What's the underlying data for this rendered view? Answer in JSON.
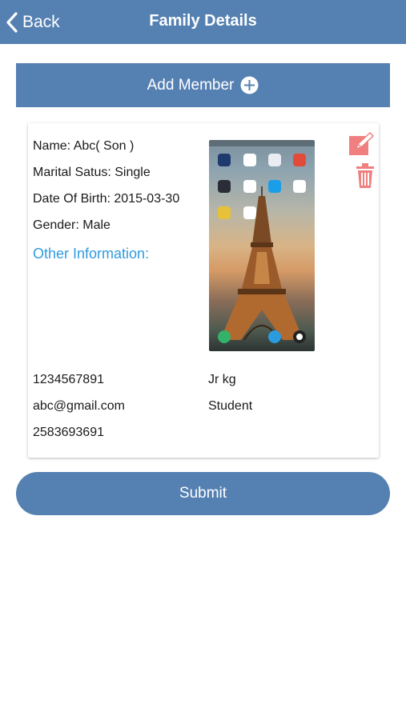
{
  "header": {
    "back_label": "Back",
    "title": "Family Details"
  },
  "add_member": {
    "label": "Add Member"
  },
  "member": {
    "name": "Name: Abc( Son )",
    "marital_status": "Marital Satus: Single",
    "date_of_birth": "Date Of Birth: 2015-03-30",
    "gender": "Gender:  Male",
    "other_information_heading": "Other Information:",
    "phone": "1234567891",
    "email": "abc@gmail.com",
    "alt_number": "2583693691",
    "class": "Jr kg",
    "occupation": "Student",
    "photo_icon": "eiffel-tower-phone-screenshot"
  },
  "actions": {
    "edit_icon": "edit-icon",
    "delete_icon": "trash-icon",
    "submit_label": "Submit"
  },
  "colors": {
    "primary": "#5580b2",
    "link_blue": "#2f9ce0",
    "action_red": "#f08080"
  }
}
